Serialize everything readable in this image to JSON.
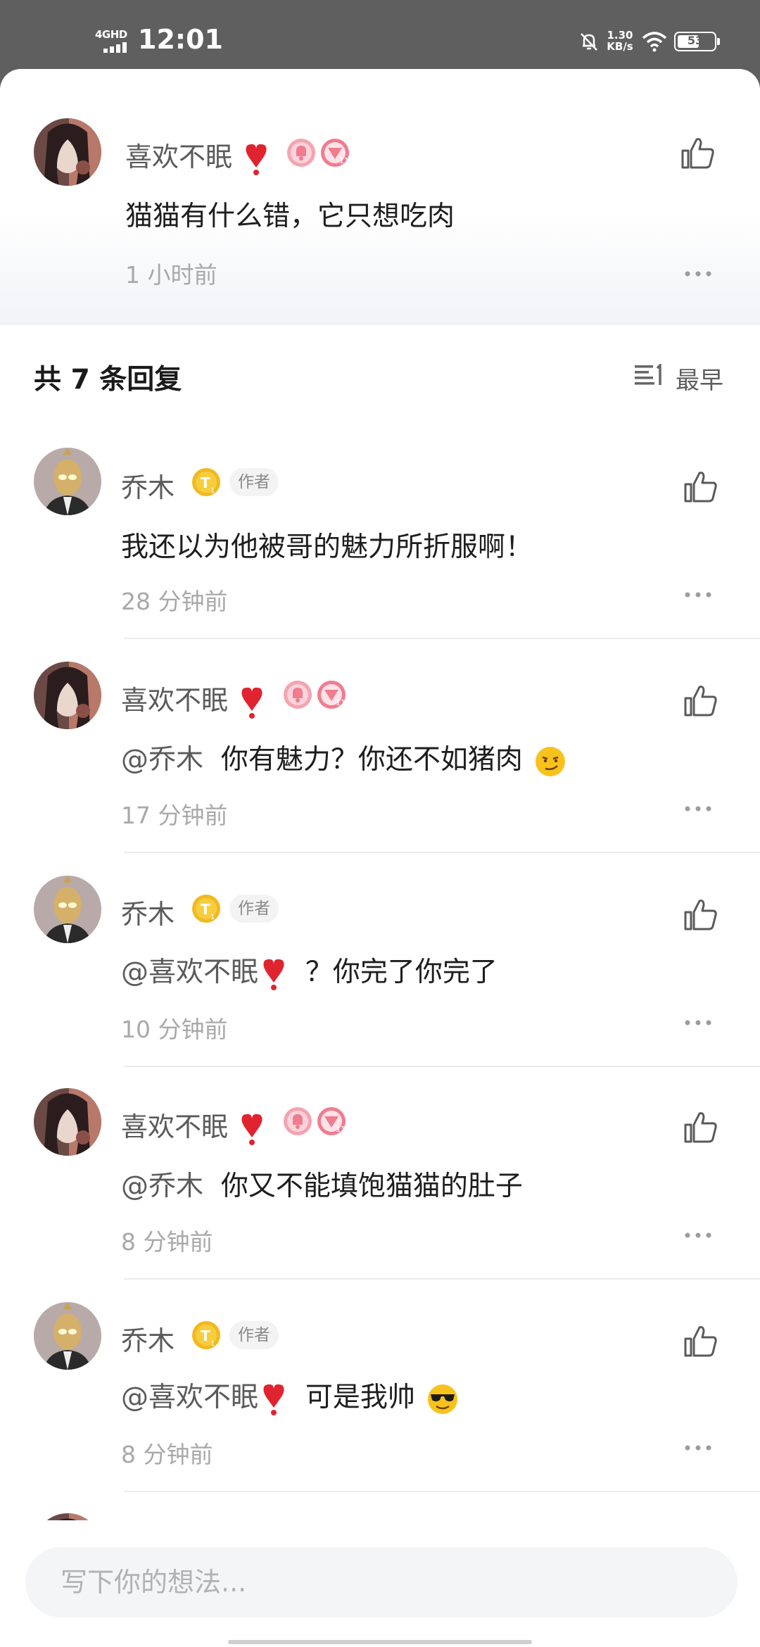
{
  "status_bar": {
    "network": "4GHD",
    "time": "12:01",
    "speed": "1.30\nKB/s",
    "speed_value": "1.30",
    "speed_unit": "KB/s",
    "battery": "53"
  },
  "parent_comment": {
    "user": "喜欢不眠",
    "text": "猫猫有什么错，它只想吃肉",
    "time": "1 小时前"
  },
  "replies_header": {
    "count_label": "共 7 条回复",
    "sort_label": "最早"
  },
  "replies": [
    {
      "user": "乔木",
      "author_badge": "作者",
      "mention": "",
      "text": "我还以为他被哥的魅力所折服啊！",
      "time": "28 分钟前"
    },
    {
      "user": "喜欢不眠",
      "mention": "@乔木",
      "text": "你有魅力？你还不如猪肉",
      "emoji": "smirk-emoji",
      "time": "17 分钟前"
    },
    {
      "user": "乔木",
      "author_badge": "作者",
      "mention": "@喜欢不眠",
      "text": "？你完了你完了",
      "time": "10 分钟前"
    },
    {
      "user": "喜欢不眠",
      "mention": "@乔木",
      "text": "你又不能填饱猫猫的肚子",
      "time": "8 分钟前"
    },
    {
      "user": "乔木",
      "author_badge": "作者",
      "mention": "@喜欢不眠",
      "text": "可是我帅",
      "emoji": "sunglasses-emoji",
      "time": "8 分钟前"
    }
  ],
  "input": {
    "placeholder": "写下你的想法..."
  },
  "colors": {
    "accent_heart": "#e0242f",
    "gold_badge": "#f2b91f",
    "pink_badge": "#f07c8f"
  }
}
